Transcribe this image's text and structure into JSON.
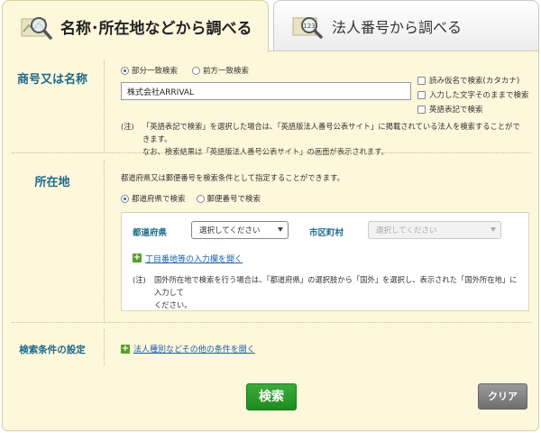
{
  "tabs": [
    {
      "label": "名称･所在地などから調べる",
      "icon": "magnifier-map-icon",
      "active": true
    },
    {
      "label": "法人番号から調べる",
      "icon": "magnifier-number-icon",
      "number_glyph": "123",
      "active": false
    }
  ],
  "name_section": {
    "label": "商号又は名称",
    "radios": [
      {
        "label": "部分一致検索",
        "selected": true
      },
      {
        "label": "前方一致検索",
        "selected": false
      }
    ],
    "input_value": "株式会社ARRIVAL",
    "checkboxes": [
      {
        "label": "読み仮名で検索(カタカナ)",
        "checked": false
      },
      {
        "label": "入力した文字そのままで検索",
        "checked": false
      },
      {
        "label": "英語表記で検索",
        "checked": false
      }
    ],
    "note_mark": "(注)",
    "note_line1": "「英語表記で検索」を選択した場合は、「英語版法人番号公表サイト」に掲載されている法人を検索することができます。",
    "note_line2": "なお、検索結果は「英語版法人番号公表サイト」の画面が表示されます。"
  },
  "address_section": {
    "label": "所在地",
    "intro": "都道府県又は郵便番号を検索条件として指定することができます。",
    "radios": [
      {
        "label": "都道府県で検索",
        "selected": true
      },
      {
        "label": "郵便番号で検索",
        "selected": false
      }
    ],
    "prefecture_label": "都道府県",
    "prefecture_select": "選択してください",
    "city_label": "市区町村",
    "city_select": "選択してください",
    "expand_link": "丁目番地等の入力欄を開く",
    "note_mark": "(注)",
    "note_line1": "国外所在地で検索を行う場合は、「都道府県」の選択肢から「国外」を選択し、表示された「国外所在地」に入力して",
    "note_line2": "ください。"
  },
  "conditions_section": {
    "label": "検索条件の設定",
    "link": "法人種別などその他の条件を開く"
  },
  "buttons": {
    "search": "検索",
    "clear": "クリア"
  },
  "colors": {
    "panel_bg": "#fdf7dc",
    "label_blue": "#1e6a8a",
    "link_blue": "#1a5fb0",
    "search_green": "#2a9a2a",
    "clear_gray": "#7f7f7f"
  }
}
